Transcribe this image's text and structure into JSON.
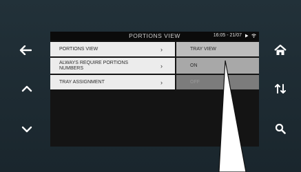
{
  "header": {
    "title": "PORTIONS VIEW",
    "time": "16:05 - 21/07"
  },
  "menu": {
    "items": [
      {
        "label": "PORTIONS VIEW",
        "value": "TRAY VIEW"
      },
      {
        "label": "ALWAYS REQUIRE PORTIONS NUMBERS",
        "value": "ON"
      },
      {
        "label": "TRAY ASSIGNMENT",
        "value": "OFF"
      }
    ],
    "chevron": "›"
  },
  "icons": {
    "back": "arrow-left-icon",
    "up": "chevron-up-icon",
    "down": "chevron-down-icon",
    "home": "home-icon",
    "sort": "sort-updown-icon",
    "search": "search-icon",
    "play": "play-icon",
    "wifi": "wifi-icon"
  },
  "colors": {
    "bezel": "#1d2a31",
    "screen": "#141414",
    "row": "#ececec",
    "value_selected": "#bdbdbd",
    "value_on": "#a8a8a8",
    "value_off": "#7c7c7c"
  }
}
